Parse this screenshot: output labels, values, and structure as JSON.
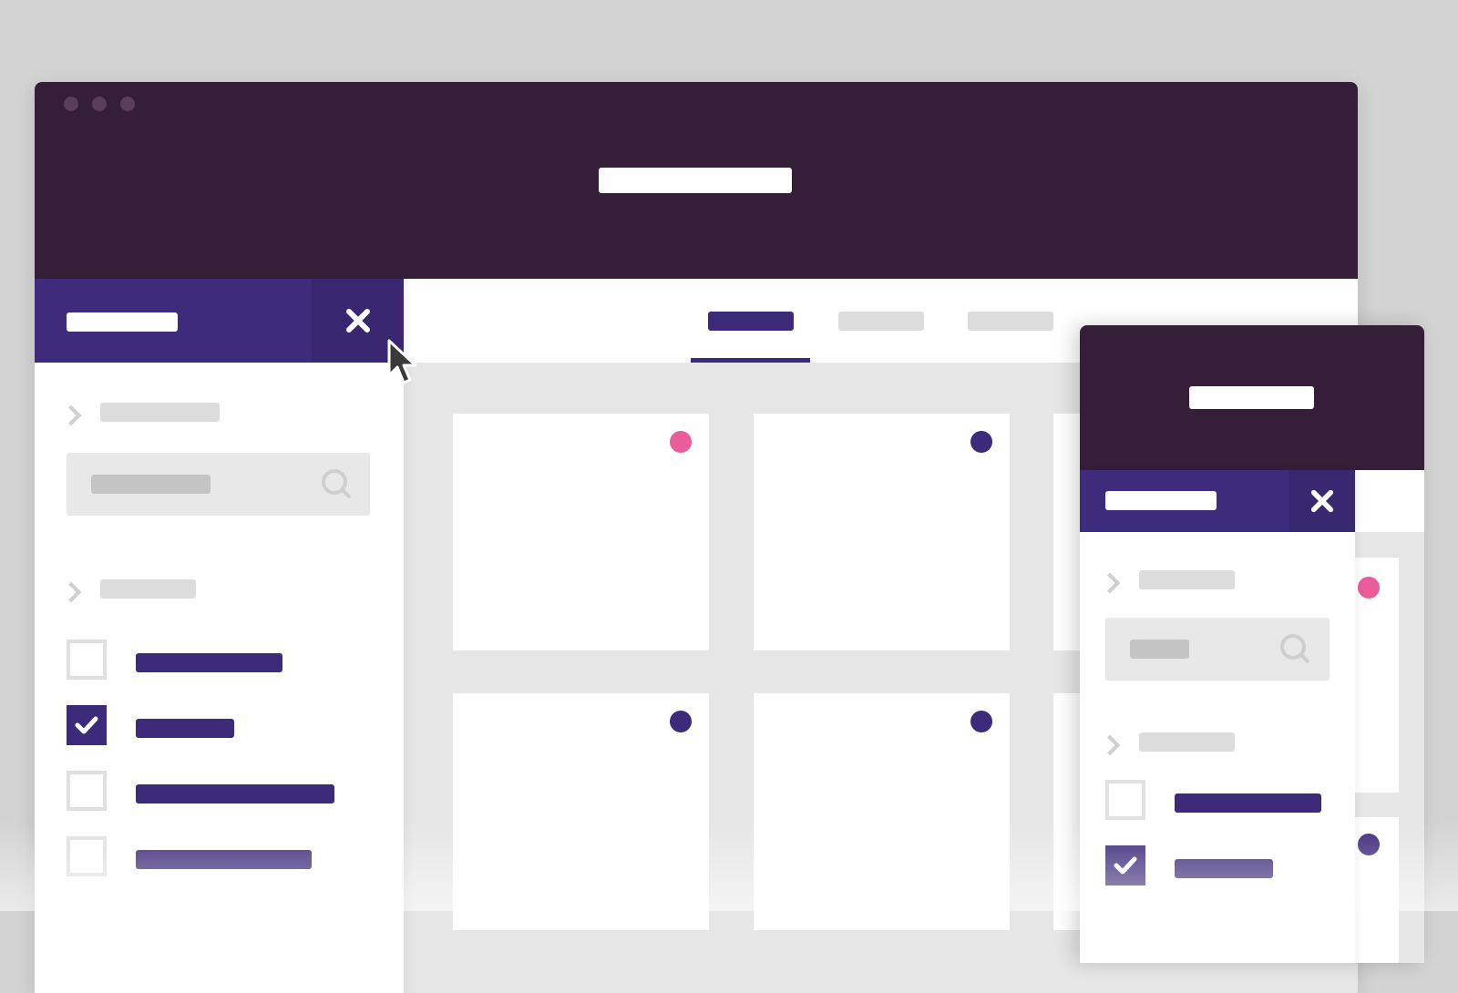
{
  "app": {
    "window_controls": [
      "close-dot",
      "minimize-dot",
      "maximize-dot"
    ],
    "title_placeholder": ""
  },
  "colors": {
    "titlebar": "#351e38",
    "accent": "#3d2a7a",
    "pink": "#ea5c9a",
    "background": "#d3d3d3"
  },
  "sidebar": {
    "header_label": "",
    "close_icon": "close-icon",
    "sections": [
      {
        "label": "",
        "icon": "chevron-right-icon",
        "search": {
          "placeholder": "",
          "icon": "search-icon"
        }
      },
      {
        "label": "",
        "icon": "chevron-right-icon",
        "filters": [
          {
            "label": "",
            "checked": false
          },
          {
            "label": "",
            "checked": true
          },
          {
            "label": "",
            "checked": false
          },
          {
            "label": "",
            "checked": false
          }
        ]
      }
    ]
  },
  "tabs": [
    {
      "label": "",
      "active": true
    },
    {
      "label": "",
      "active": false
    },
    {
      "label": "",
      "active": false
    }
  ],
  "cards": [
    {
      "status": "pink"
    },
    {
      "status": "purple"
    },
    {
      "status": "purple"
    },
    {
      "status": "purple"
    }
  ],
  "secondary_window": {
    "title_placeholder": "",
    "sidebar_header_label": "",
    "filters": [
      {
        "label": "",
        "checked": false
      },
      {
        "label": "",
        "checked": true
      }
    ]
  }
}
